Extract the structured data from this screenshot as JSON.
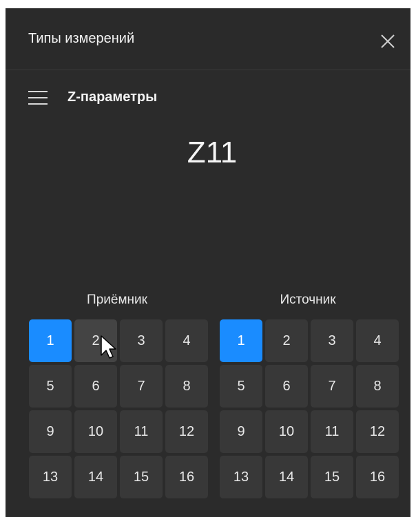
{
  "header": {
    "title": "Типы измерений",
    "close_icon": "close-icon"
  },
  "menu": {
    "icon": "hamburger-icon",
    "title": "Z-параметры"
  },
  "measurement": {
    "value": "Z11"
  },
  "receiver": {
    "label": "Приёмник",
    "selected": "1",
    "ports": [
      "1",
      "2",
      "3",
      "4",
      "5",
      "6",
      "7",
      "8",
      "9",
      "10",
      "11",
      "12",
      "13",
      "14",
      "15",
      "16"
    ]
  },
  "source": {
    "label": "Источник",
    "selected": "1",
    "ports": [
      "1",
      "2",
      "3",
      "4",
      "5",
      "6",
      "7",
      "8",
      "9",
      "10",
      "11",
      "12",
      "13",
      "14",
      "15",
      "16"
    ]
  },
  "colors": {
    "panel_bg": "#2b2b2b",
    "button_bg": "#383838",
    "selected_bg": "#1a8cff",
    "text": "#e6e6e6"
  },
  "hovered_receiver_port": "2"
}
